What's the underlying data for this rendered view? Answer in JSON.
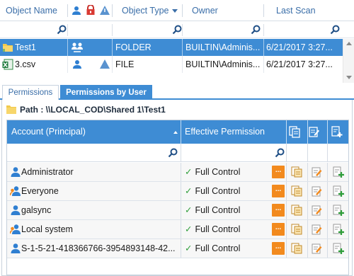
{
  "object_grid": {
    "columns": {
      "name": "Object Name",
      "type": "Object Type",
      "owner": "Owner",
      "last_scan": "Last Scan"
    },
    "rows": [
      {
        "name": "Test1",
        "type": "FOLDER",
        "owner": "BUILTIN\\Adminis...",
        "last_scan": "6/21/2017 3:27...",
        "selected": true
      },
      {
        "name": "3.csv",
        "type": "FILE",
        "owner": "BUILTIN\\Adminis...",
        "last_scan": "6/21/2017 3:27...",
        "selected": false
      }
    ]
  },
  "tabs": [
    {
      "label": "Permissions",
      "active": false
    },
    {
      "label": "Permissions by User",
      "active": true
    }
  ],
  "path": "Path : \\\\LOCAL_COD\\Shared 1\\Test1",
  "permissions_grid": {
    "columns": {
      "account": "Account (Principal)",
      "effective": "Effective Permission"
    },
    "more_label": "...",
    "rows": [
      {
        "account": "Administrator",
        "permission": "Full Control"
      },
      {
        "account": "Everyone",
        "permission": "Full Control"
      },
      {
        "account": "galsync",
        "permission": "Full Control"
      },
      {
        "account": "Local system",
        "permission": "Full Control"
      },
      {
        "account": "S-1-5-21-418366766-3954893148-42...",
        "permission": "Full Control"
      }
    ]
  },
  "colors": {
    "accent": "#3e8cd4",
    "header_text": "#3a6ea8",
    "more_button": "#f28a1e",
    "check": "#2e9e3a"
  }
}
